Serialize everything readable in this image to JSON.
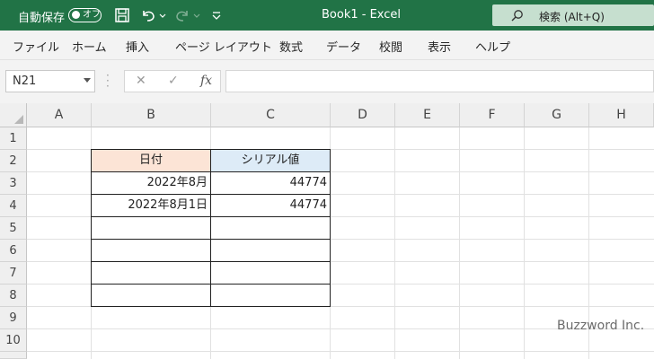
{
  "titlebar": {
    "autosave_label": "自動保存",
    "autosave_state": "オフ",
    "title": "Book1  -  Excel",
    "search_placeholder": "検索 (Alt+Q)",
    "bg_color": "#217346"
  },
  "menu": [
    "ファイル",
    "ホーム",
    "挿入",
    "ページ レイアウト",
    "数式",
    "データ",
    "校閲",
    "表示",
    "ヘルプ"
  ],
  "formula_bar": {
    "name_box": "N21",
    "cancel_icon": "✕",
    "enter_icon": "✓",
    "fx_label": "fx",
    "formula": ""
  },
  "grid": {
    "columns": [
      "A",
      "B",
      "C",
      "D",
      "E",
      "F",
      "G",
      "H"
    ],
    "rows": [
      "1",
      "2",
      "3",
      "4",
      "5",
      "6",
      "7",
      "8",
      "9",
      "10"
    ],
    "table": {
      "header_b": "日付",
      "header_c": "シリアル値",
      "header_b_fill": "#fce4d6",
      "header_c_fill": "#ddebf7",
      "rows": [
        {
          "b": "2022年8月",
          "c": "44774"
        },
        {
          "b": "2022年8月1日",
          "c": "44774"
        },
        {
          "b": "",
          "c": ""
        },
        {
          "b": "",
          "c": ""
        },
        {
          "b": "",
          "c": ""
        },
        {
          "b": "",
          "c": ""
        }
      ]
    }
  },
  "watermark": "Buzzword Inc."
}
